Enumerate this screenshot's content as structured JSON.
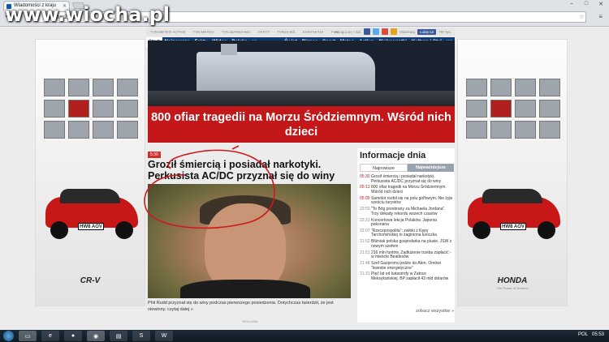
{
  "browser": {
    "tab_title": "Wiadomości z kraju",
    "url": "www.tvn24.pl",
    "watermark": "www.wiocha.pl"
  },
  "topstrip": {
    "links": [
      "TVN METEO ACTIVE",
      "TVN METEO",
      "TVN WARSZAWA",
      "FAKTY",
      "TVN24 BiŚ",
      "KONTAKT24",
      "TVN"
    ],
    "login": "Zaloguj się / Zał.",
    "follow": "Obserwuj",
    "like": "Lubię to!",
    "likes": "787 tys."
  },
  "nav": {
    "items": [
      "Start",
      "Najnowsze",
      "Fakty",
      "Wideo",
      "Polska",
      "Warszawa ▾",
      "Świat",
      "Biznes",
      "Sport",
      "Meteo",
      "Active",
      "Ciekawostki",
      "Kultura i Styl",
      "Więcej ▾"
    ]
  },
  "hero": {
    "headline": "800 ofiar tragedii na Morzu Śródziemnym. Wśród nich dzieci"
  },
  "article": {
    "time": "5:30",
    "headline": "Groził śmiercią i posiadał narkotyki. Perkusista AC/DC przyznał się do winy",
    "caption": "Phil Rudd przyznał się do winy podczas pierwszego posiedzenia. Dotychczas twierdził, że jest niewinny.",
    "more": "czytaj dalej »",
    "teaser_label": "REKLAMA"
  },
  "ads": {
    "left_model": "CR-V",
    "right_brand": "HONDA",
    "right_sub": "The Power of Dreams",
    "plate": "HW8 AOV"
  },
  "info": {
    "title": "Informacje dnia",
    "tab_new": "Najnowsze",
    "tab_important": "Najważniejsze",
    "items": [
      {
        "time": "05:30",
        "text": "Groził śmiercią i posiadał narkotyki. Perkusista AC/DC przyznał się do winy",
        "hot": true
      },
      {
        "time": "05:13",
        "text": "800 ofiar tragedii na Morzu Śródziemnym. Wśród nich dzieci",
        "hot": true
      },
      {
        "time": "05:05",
        "text": "Samolot rozbił się na polu golfowym. Nie żyje sześciu turystów",
        "hot": true
      },
      {
        "time": "22:50",
        "text": "\"To Bóg przebrany za Michaela Jordana\". Trzy dekady rekordu wszech czasów",
        "hot": false
      },
      {
        "time": "22:21",
        "text": "Koncertowa lekcja Polaków. Japonia pokonana",
        "hot": false
      },
      {
        "time": "22:07",
        "text": "\"Rzeczpospolita\": zwłoki z Kępy Tarchomińskiej to zaginiona łuniczka",
        "hot": false
      },
      {
        "time": "21:52",
        "text": "Bliźniak polska gospodarka na plusie. JSW z nowym szefem",
        "hot": false
      },
      {
        "time": "21:51",
        "text": "216 mln funtów. Zadłużenie trzeba zapłacić - w mieście Beatlesów",
        "hot": false
      },
      {
        "time": "21:48",
        "text": "Szef Gazpromu jedzie do Aten. Omówi \"kwestie energetyczne\"",
        "hot": false
      },
      {
        "time": "21:31",
        "text": "Pięć lat od katastrofy w Zatoce Meksykańskiej. BP zapłacił 43 mld dolarów",
        "hot": false
      }
    ],
    "see_all": "zobacz wszystkie »"
  },
  "taskbar": {
    "lang": "POL",
    "clock": "05:53"
  },
  "colors": {
    "nav_bg": "#0d3b6f",
    "hero_red": "#c4171a",
    "news_time_red": "#c31a1a"
  }
}
